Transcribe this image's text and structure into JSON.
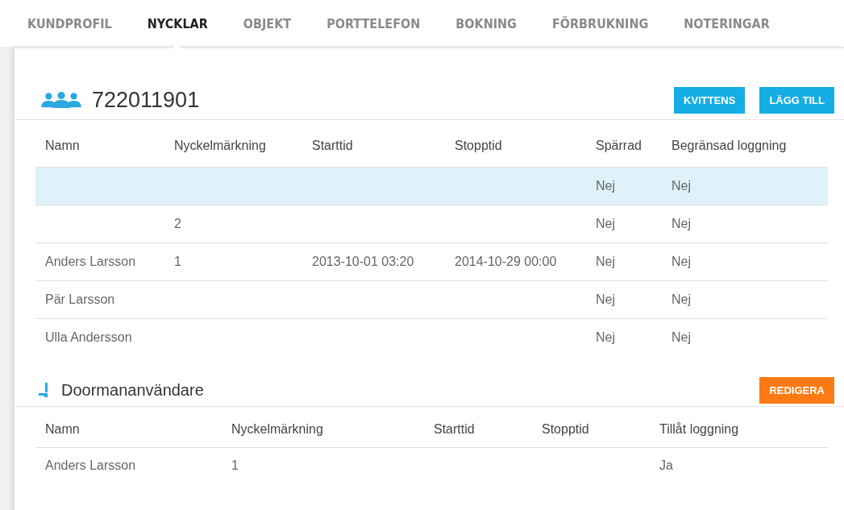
{
  "tabs": [
    {
      "label": "KUNDPROFIL",
      "selected": false
    },
    {
      "label": "NYCKLAR",
      "selected": true
    },
    {
      "label": "OBJEKT",
      "selected": false
    },
    {
      "label": "PORTTELEFON",
      "selected": false
    },
    {
      "label": "BOKNING",
      "selected": false
    },
    {
      "label": "FÖRBRUKNING",
      "selected": false
    },
    {
      "label": "NOTERINGAR",
      "selected": false
    }
  ],
  "keys_section": {
    "title": "722011901",
    "buttons": [
      "KVITTENS",
      "LÄGG TILL"
    ],
    "columns": [
      "Namn",
      "Nyckelmärkning",
      "Starttid",
      "Stopptid",
      "Spärrad",
      "Begränsad loggning"
    ],
    "rows": [
      {
        "selected": true,
        "cells": [
          "",
          "",
          "",
          "",
          "Nej",
          "Nej"
        ]
      },
      {
        "selected": false,
        "cells": [
          "",
          "2",
          "",
          "",
          "Nej",
          "Nej"
        ]
      },
      {
        "selected": false,
        "cells": [
          "Anders Larsson",
          "1",
          "2013-10-01 03:20",
          "2014-10-29 00:00",
          "Nej",
          "Nej"
        ]
      },
      {
        "selected": false,
        "cells": [
          "Pär Larsson",
          "",
          "",
          "",
          "Nej",
          "Nej"
        ]
      },
      {
        "selected": false,
        "cells": [
          "Ulla Andersson",
          "",
          "",
          "",
          "Nej",
          "Nej"
        ]
      }
    ]
  },
  "doorman_section": {
    "title": "Doormananvändare",
    "button": "REDIGERA",
    "columns": [
      "Namn",
      "Nyckelmärkning",
      "Starttid",
      "Stopptid",
      "Tillåt loggning"
    ],
    "rows": [
      {
        "cells": [
          "Anders Larsson",
          "1",
          "",
          "",
          "Ja"
        ]
      }
    ]
  }
}
